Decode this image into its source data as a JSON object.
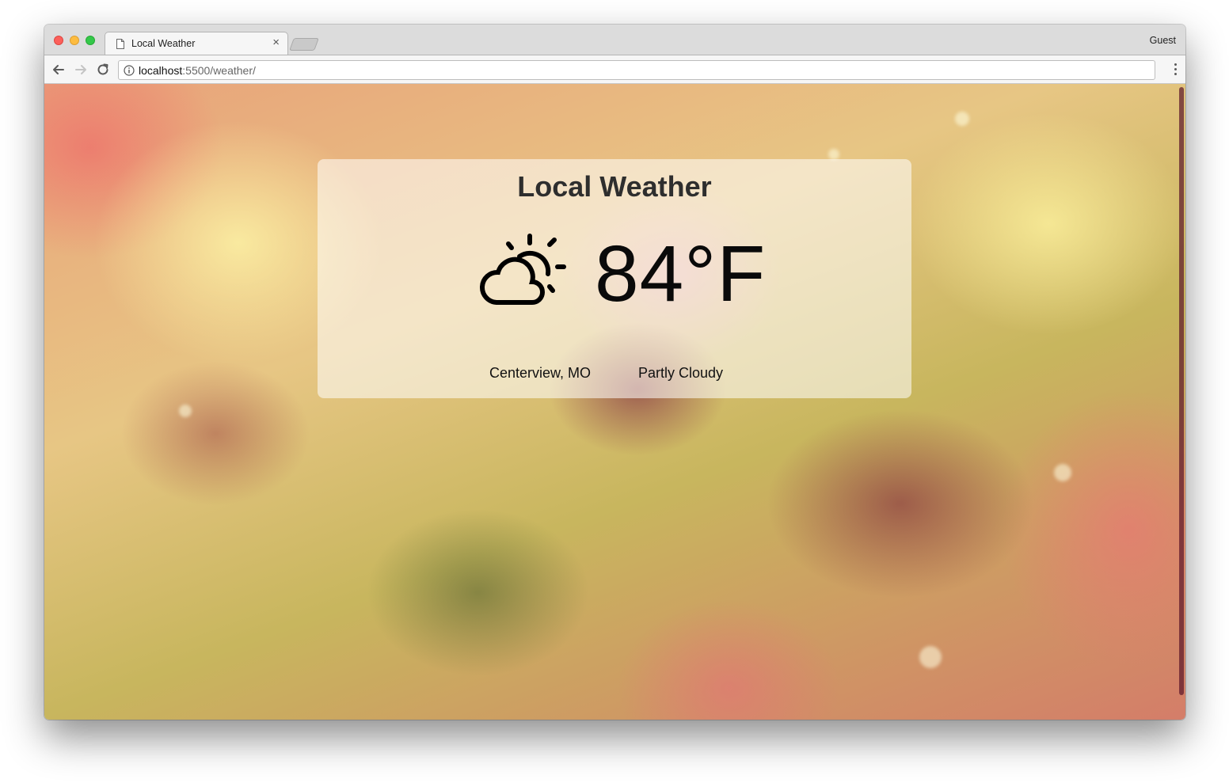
{
  "browser": {
    "tab_title": "Local Weather",
    "tab_close": "×",
    "profile_label": "Guest",
    "url_host": "localhost",
    "url_rest": ":5500/weather/"
  },
  "weather": {
    "title": "Local Weather",
    "temperature": "84°F",
    "location": "Centerview, MO",
    "condition": "Partly Cloudy",
    "icon": "partly-cloudy-icon"
  },
  "colors": {
    "card_background": "#ffffffcc",
    "title_text": "#2e2e2e",
    "traffic_red": "#fc605b",
    "traffic_yellow": "#fdbc40",
    "traffic_green": "#34c84a"
  }
}
